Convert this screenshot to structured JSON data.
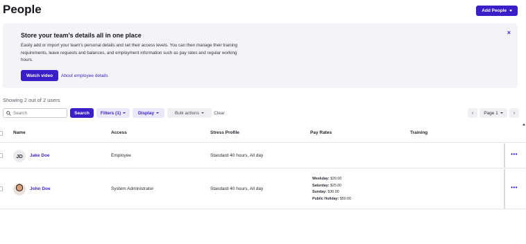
{
  "header": {
    "title": "People",
    "add_people_label": "Add People"
  },
  "banner": {
    "title": "Store your team's details all in one place",
    "text": "Easily add or import your team's personal details and set their access levels. You can then manage their training requirements, leave requests and balances, and employment information such as pay rates and regular working hours.",
    "close_glyph": "×",
    "watch_video_label": "Watch video",
    "about_link_label": "About employee details"
  },
  "summary": {
    "showing_text": "Showing 2 out of 2 users"
  },
  "toolbar": {
    "search_placeholder": "Search",
    "search_button_label": "Search",
    "filters_label": "Filters (1)",
    "display_label": "Display",
    "bulk_actions_label": "Bulk actions",
    "clear_label": "Clear"
  },
  "pager": {
    "prev_glyph": "‹",
    "page_label": "Page 1",
    "next_glyph": "›"
  },
  "table": {
    "columns": [
      "Name",
      "Access",
      "Stress Profile",
      "Pay Rates",
      "Training"
    ],
    "rows": [
      {
        "initials": "JD",
        "name": "Jake Doe",
        "access": "Employee",
        "stress_profile": "Standard 40 hours, All day",
        "pay_rates": [],
        "more": "•••"
      },
      {
        "initials": "",
        "name": "John Doe",
        "access": "System Administrator",
        "stress_profile": "Standard 40 hours, All day",
        "pay_rates": [
          {
            "label": "Weekday:",
            "value": "$20.00"
          },
          {
            "label": "Saturday:",
            "value": "$25.00"
          },
          {
            "label": "Sunday:",
            "value": "$30.00"
          },
          {
            "label": "Public Holiday:",
            "value": "$50.00"
          }
        ],
        "more": "•••"
      }
    ]
  },
  "colors": {
    "primary": "#3a1fc9",
    "banner_bg": "#f4f4f8",
    "pill_bg": "#ebe8fb"
  },
  "icons": [
    "search-icon",
    "close-icon",
    "chevron-down-icon",
    "chevron-left-icon",
    "chevron-right-icon",
    "more-icon"
  ]
}
